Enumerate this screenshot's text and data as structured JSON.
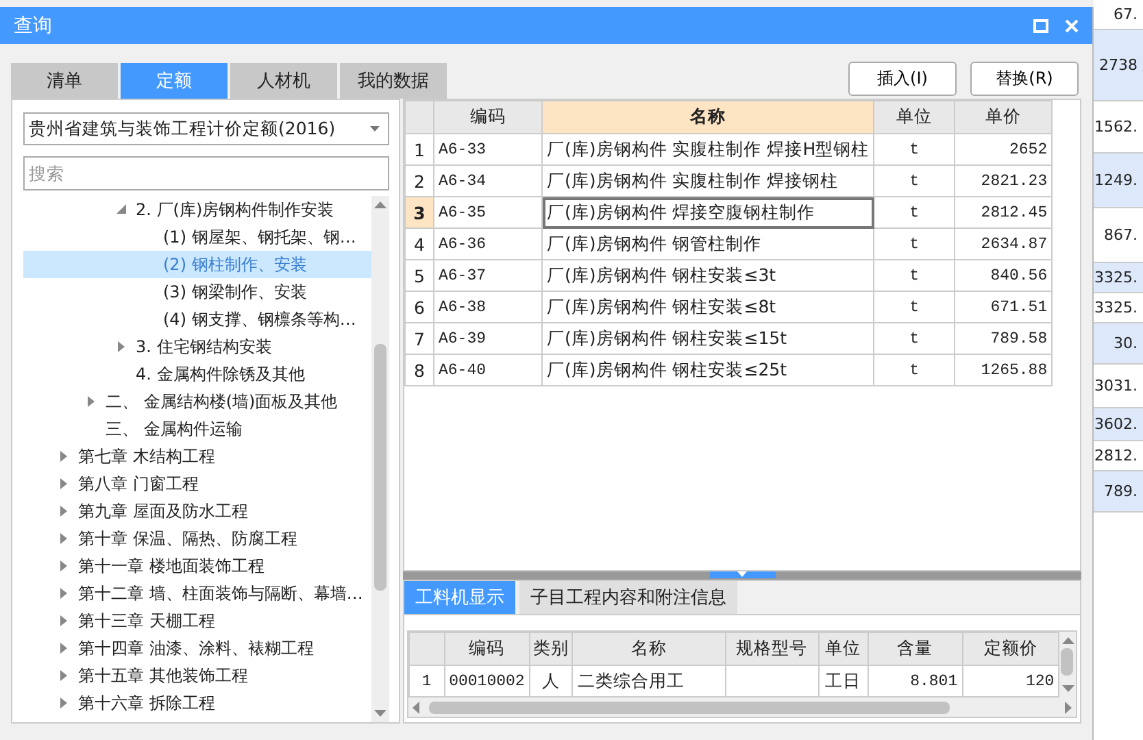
{
  "background_values": [
    "67.",
    "2738",
    "1562.",
    "1249.",
    "867.",
    "3325.",
    "3325.",
    "30.",
    "3031.",
    "3602.",
    "2812.",
    "789."
  ],
  "window": {
    "title": "查询"
  },
  "tabs": [
    {
      "label": "清单",
      "selected": false
    },
    {
      "label": "定额",
      "selected": true
    },
    {
      "label": "人材机",
      "selected": false
    },
    {
      "label": "我的数据",
      "selected": false
    }
  ],
  "buttons": [
    "插入(I)",
    "替换(R)"
  ],
  "library_select": {
    "value": "贵州省建筑与装饰工程计价定额(2016)"
  },
  "search": {
    "placeholder": "搜索"
  },
  "tree": [
    {
      "kind": "subsection",
      "label": "2. 厂(库)房钢构件制作安装",
      "expanded": true,
      "selected": false,
      "children": [
        {
          "kind": "entry",
          "label": "(1) 钢屋架、钢托架、钢…",
          "selected": false
        },
        {
          "kind": "entry",
          "label": "(2) 钢柱制作、安装",
          "selected": true
        },
        {
          "kind": "entry",
          "label": "(3) 钢梁制作、安装",
          "selected": false
        },
        {
          "kind": "entry",
          "label": "(4) 钢支撑、钢檩条等构…",
          "selected": false
        }
      ]
    },
    {
      "kind": "subsection",
      "label": "3. 住宅钢结构安装",
      "expanded": false,
      "selected": false
    },
    {
      "kind": "subsection",
      "label": "4. 金属构件除锈及其他",
      "selected": false
    },
    {
      "kind": "section",
      "label": "二、  金属结构楼(墙)面板及其他",
      "expanded": false,
      "selected": false
    },
    {
      "kind": "section",
      "label": "三、  金属构件运输",
      "selected": false
    },
    {
      "kind": "chapter",
      "label": "第七章 木结构工程",
      "expanded": false,
      "selected": false
    },
    {
      "kind": "chapter",
      "label": "第八章 门窗工程",
      "expanded": false,
      "selected": false
    },
    {
      "kind": "chapter",
      "label": "第九章 屋面及防水工程",
      "expanded": false,
      "selected": false
    },
    {
      "kind": "chapter",
      "label": "第十章 保温、隔热、防腐工程",
      "expanded": false,
      "selected": false
    },
    {
      "kind": "chapter",
      "label": "第十一章 楼地面装饰工程",
      "expanded": false,
      "selected": false
    },
    {
      "kind": "chapter",
      "label": "第十二章 墙、柱面装饰与隔断、幕墙…",
      "expanded": false,
      "selected": false
    },
    {
      "kind": "chapter",
      "label": "第十三章 天棚工程",
      "expanded": false,
      "selected": false
    },
    {
      "kind": "chapter",
      "label": "第十四章 油漆、涂料、裱糊工程",
      "expanded": false,
      "selected": false
    },
    {
      "kind": "chapter",
      "label": "第十五章 其他装饰工程",
      "expanded": false,
      "selected": false
    },
    {
      "kind": "chapter",
      "label": "第十六章 拆除工程",
      "expanded": false,
      "selected": false
    }
  ],
  "quota_table": {
    "columns": [
      "编码",
      "名称",
      "单位",
      "单价"
    ],
    "rows": [
      {
        "index": "1",
        "code": "A6-33",
        "name": "厂(库)房钢构件 实腹柱制作 焊接H型钢柱",
        "unit": "t",
        "price": "2652",
        "selected": false
      },
      {
        "index": "2",
        "code": "A6-34",
        "name": "厂(库)房钢构件 实腹柱制作 焊接钢柱",
        "unit": "t",
        "price": "2821.23",
        "selected": false
      },
      {
        "index": "3",
        "code": "A6-35",
        "name": "厂(库)房钢构件 焊接空腹钢柱制作",
        "unit": "t",
        "price": "2812.45",
        "selected": true
      },
      {
        "index": "4",
        "code": "A6-36",
        "name": "厂(库)房钢构件 钢管柱制作",
        "unit": "t",
        "price": "2634.87",
        "selected": false
      },
      {
        "index": "5",
        "code": "A6-37",
        "name": "厂(库)房钢构件 钢柱安装≤3t",
        "unit": "t",
        "price": "840.56",
        "selected": false
      },
      {
        "index": "6",
        "code": "A6-38",
        "name": "厂(库)房钢构件 钢柱安装≤8t",
        "unit": "t",
        "price": "671.51",
        "selected": false
      },
      {
        "index": "7",
        "code": "A6-39",
        "name": "厂(库)房钢构件 钢柱安装≤15t",
        "unit": "t",
        "price": "789.58",
        "selected": false
      },
      {
        "index": "8",
        "code": "A6-40",
        "name": "厂(库)房钢构件 钢柱安装≤25t",
        "unit": "t",
        "price": "1265.88",
        "selected": false
      }
    ]
  },
  "detail_tabs": [
    {
      "label": "工料机显示",
      "selected": true
    },
    {
      "label": "子目工程内容和附注信息",
      "selected": false
    }
  ],
  "resource_table": {
    "columns": [
      "编码",
      "类别",
      "名称",
      "规格型号",
      "单位",
      "含量",
      "定额价"
    ],
    "rows": [
      {
        "index": "1",
        "cells": [
          "00010002",
          "人",
          "二类综合用工",
          "",
          "工日",
          "8.801",
          "120"
        ]
      }
    ]
  }
}
